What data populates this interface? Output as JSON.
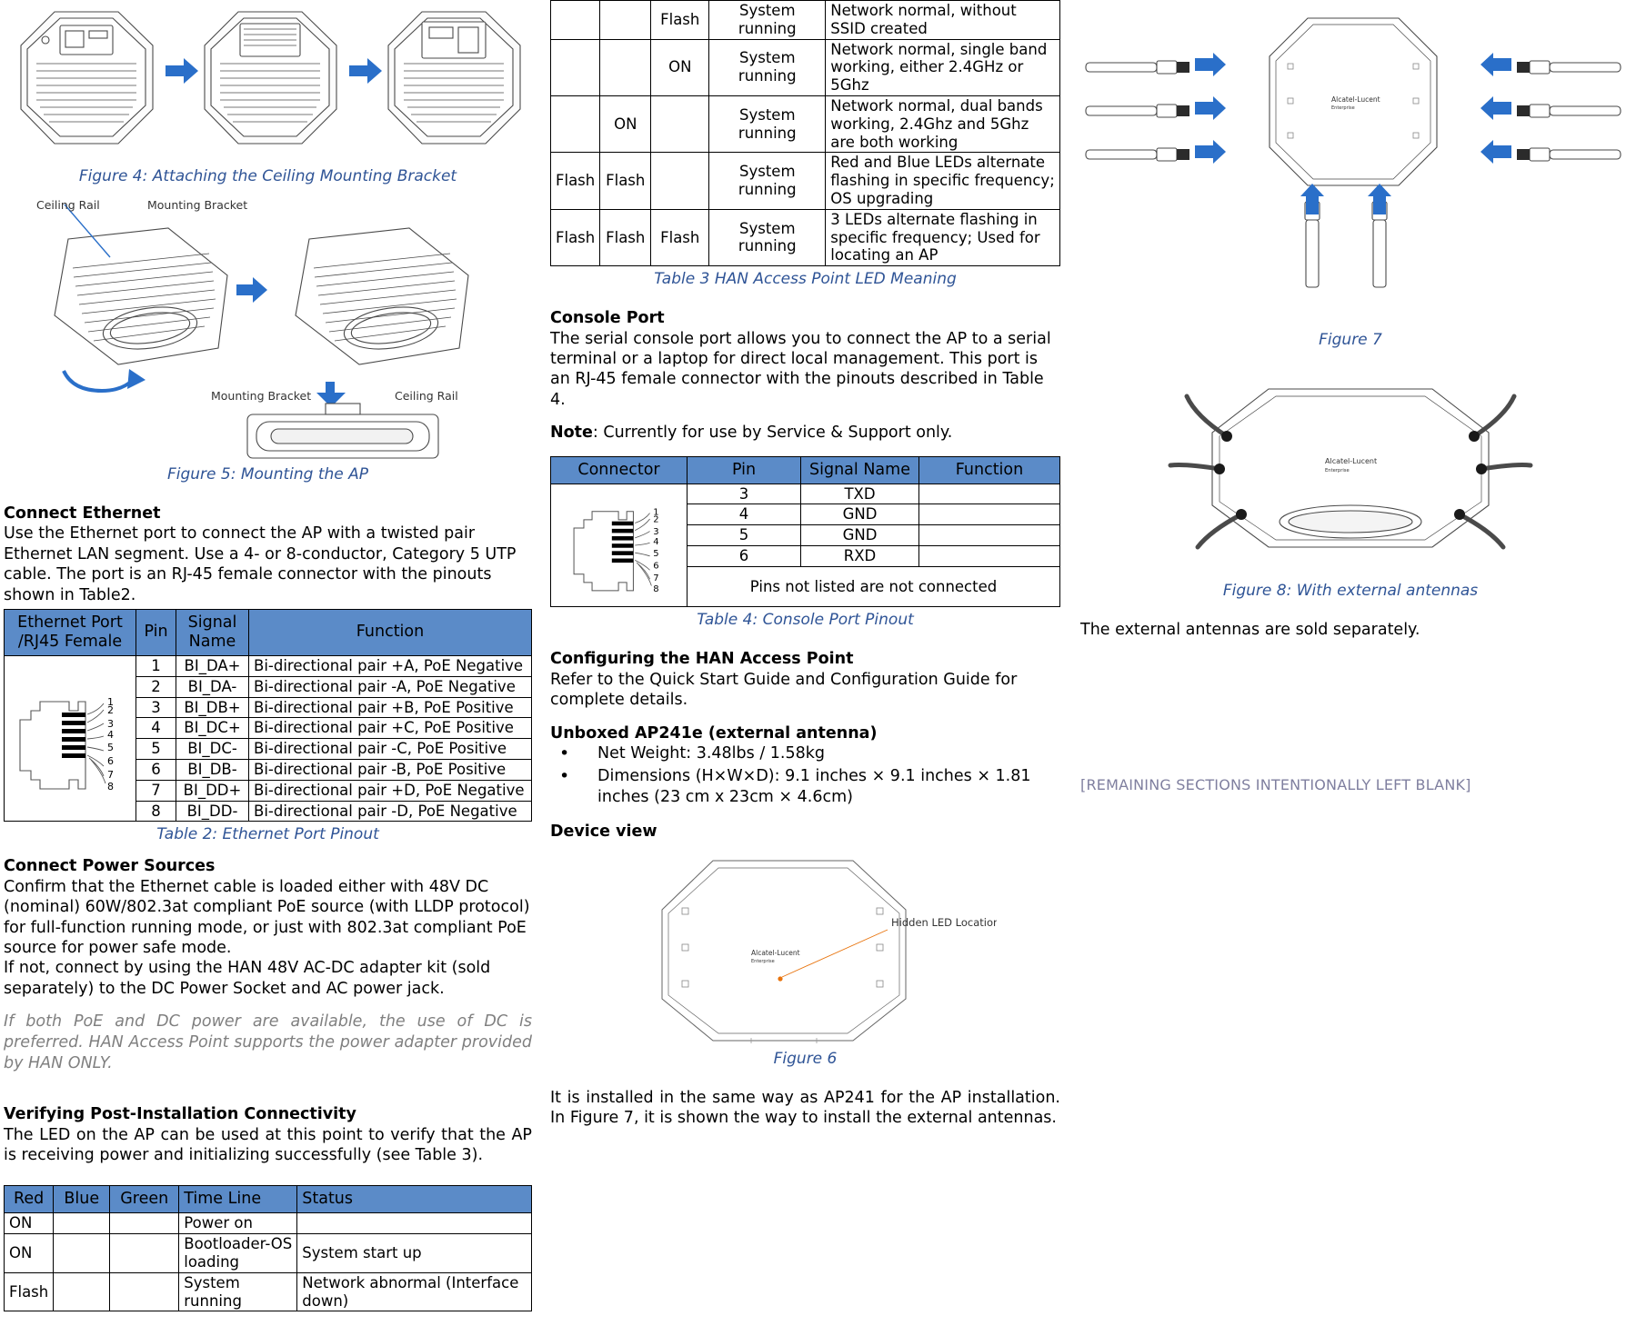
{
  "left": {
    "fig4_caption": "Figure 4: Attaching the Ceiling Mounting Bracket",
    "fig5_caption": "Figure 5: Mounting the AP",
    "fig5_labels": {
      "ceiling_rail": "Ceiling Rail",
      "mounting_bracket": "Mounting Bracket",
      "mounting_bracket_2": "Mounting Bracket",
      "ceiling_rail_2": "Ceiling Rail"
    },
    "connect_ethernet": {
      "heading": "Connect Ethernet",
      "body": "Use the Ethernet port to connect the AP with a twisted pair Ethernet LAN segment. Use a 4- or 8-conductor, Category 5 UTP cable. The port is an RJ-45 female connector with the pinouts shown in Table2."
    },
    "table2": {
      "caption": "Table 2: Ethernet Port Pinout",
      "headers": [
        "Ethernet Port /RJ45 Female",
        "Pin",
        "Signal Name",
        "Function"
      ],
      "rows": [
        [
          "1",
          "BI_DA+",
          "Bi-directional pair +A, PoE Negative"
        ],
        [
          "2",
          "BI_DA-",
          "Bi-directional pair -A, PoE Negative"
        ],
        [
          "3",
          "BI_DB+",
          "Bi-directional pair +B, PoE Positive"
        ],
        [
          "4",
          "BI_DC+",
          "Bi-directional pair +C, PoE Positive"
        ],
        [
          "5",
          "BI_DC-",
          "Bi-directional pair -C, PoE Positive"
        ],
        [
          "6",
          "BI_DB-",
          "Bi-directional pair -B, PoE Positive"
        ],
        [
          "7",
          "BI_DD+",
          "Bi-directional pair +D, PoE Negative"
        ],
        [
          "8",
          "BI_DD-",
          "Bi-directional pair -D, PoE Negative"
        ]
      ],
      "pin_labels": [
        "1",
        "2",
        "3",
        "4",
        "5",
        "6",
        "7",
        "8"
      ]
    },
    "connect_power": {
      "heading": "Connect Power Sources",
      "body1": "Confirm that the Ethernet cable is loaded either with 48V DC (nominal) 60W/802.3at compliant PoE source (with LLDP protocol) for full-function running mode, or just with 802.3at compliant PoE source for power safe mode.",
      "body2": "If not, connect by using the HAN 48V AC-DC adapter kit (sold separately) to the DC Power Socket and AC power jack.",
      "italic_note": "If both PoE and DC power are available, the use of DC is preferred. HAN Access Point supports the power adapter provided by HAN ONLY."
    },
    "verifying": {
      "heading": "Verifying Post-Installation Connectivity",
      "body": "The LED on the AP can be used at this point to verify that the AP is receiving power and initializing successfully (see Table 3)."
    },
    "table3_headers": [
      "Red",
      "Blue",
      "Green",
      "Time Line",
      "Status"
    ],
    "table3_rows_left": [
      [
        "ON",
        "",
        "",
        "Power on",
        ""
      ],
      [
        "ON",
        "",
        "",
        "Bootloader-OS loading",
        "System start up"
      ],
      [
        "Flash",
        "",
        "",
        "System running",
        "Network abnormal (Interface down)"
      ]
    ]
  },
  "mid": {
    "table3_rows_cont": [
      [
        "",
        "",
        "Flash",
        "System running",
        "Network normal, without SSID created"
      ],
      [
        "",
        "",
        "ON",
        "System running",
        "Network normal, single band working, either 2.4GHz or 5Ghz"
      ],
      [
        "",
        "ON",
        "",
        "System running",
        "Network normal, dual bands working, 2.4Ghz and 5Ghz are both working"
      ],
      [
        "Flash",
        "Flash",
        "",
        "System running",
        "Red and Blue LEDs alternate flashing in specific frequency; OS upgrading"
      ],
      [
        "Flash",
        "Flash",
        "Flash",
        "System running",
        "3 LEDs alternate flashing in specific frequency; Used for locating an AP"
      ]
    ],
    "table3_caption": "Table 3 HAN Access Point LED Meaning",
    "console_port": {
      "heading": "Console Port",
      "body": "The serial console port allows you to connect the AP to a serial terminal or a laptop for direct local management. This port is an RJ-45 female connector with the pinouts described in Table 4.",
      "note_label": "Note",
      "note_text": ": Currently for use by Service & Support only."
    },
    "table4": {
      "caption": "Table 4: Console Port Pinout",
      "headers": [
        "Connector",
        "Pin",
        "Signal Name",
        "Function"
      ],
      "rows": [
        [
          "3",
          "TXD",
          ""
        ],
        [
          "4",
          "GND",
          ""
        ],
        [
          "5",
          "GND",
          ""
        ],
        [
          "6",
          "RXD",
          ""
        ]
      ],
      "footer": "Pins not listed are not connected",
      "pin_labels": [
        "1",
        "2",
        "3",
        "4",
        "5",
        "6",
        "7",
        "8"
      ]
    },
    "configuring": {
      "heading": "Configuring the HAN Access Point",
      "body": "Refer to the Quick Start Guide and Configuration Guide for complete details."
    },
    "unboxed": {
      "heading": "Unboxed AP241e (external antenna)",
      "bullets": [
        "Net Weight: 3.48lbs / 1.58kg",
        "Dimensions (H×W×D): 9.1 inches × 9.1 inches × 1.81 inches (23 cm x 23cm × 4.6cm)"
      ]
    },
    "device_view": {
      "heading": "Device view",
      "fig6_caption": "Figure 6",
      "hidden_led_label": "Hidden LED  Location",
      "brand": "Alcatel-Lucent",
      "brand_sub": "Enterprise"
    },
    "closing": "It is installed in the same way as AP241 for the AP installation. In Figure 7, it is shown the way to install the external antennas."
  },
  "right": {
    "fig7_caption": "Figure 7",
    "fig8_caption": "Figure 8: With external antennas",
    "antenna_note": "The external antennas are sold separately.",
    "remaining": "[REMAINING SECTIONS INTENTIONALLY LEFT BLANK]",
    "brand": "Alcatel-Lucent",
    "brand_sub": "Enterprise"
  },
  "colors": {
    "table_header": "#5b8bc8",
    "caption": "#2f5496",
    "arrow": "#2a6fc9",
    "muted": "#808080"
  }
}
